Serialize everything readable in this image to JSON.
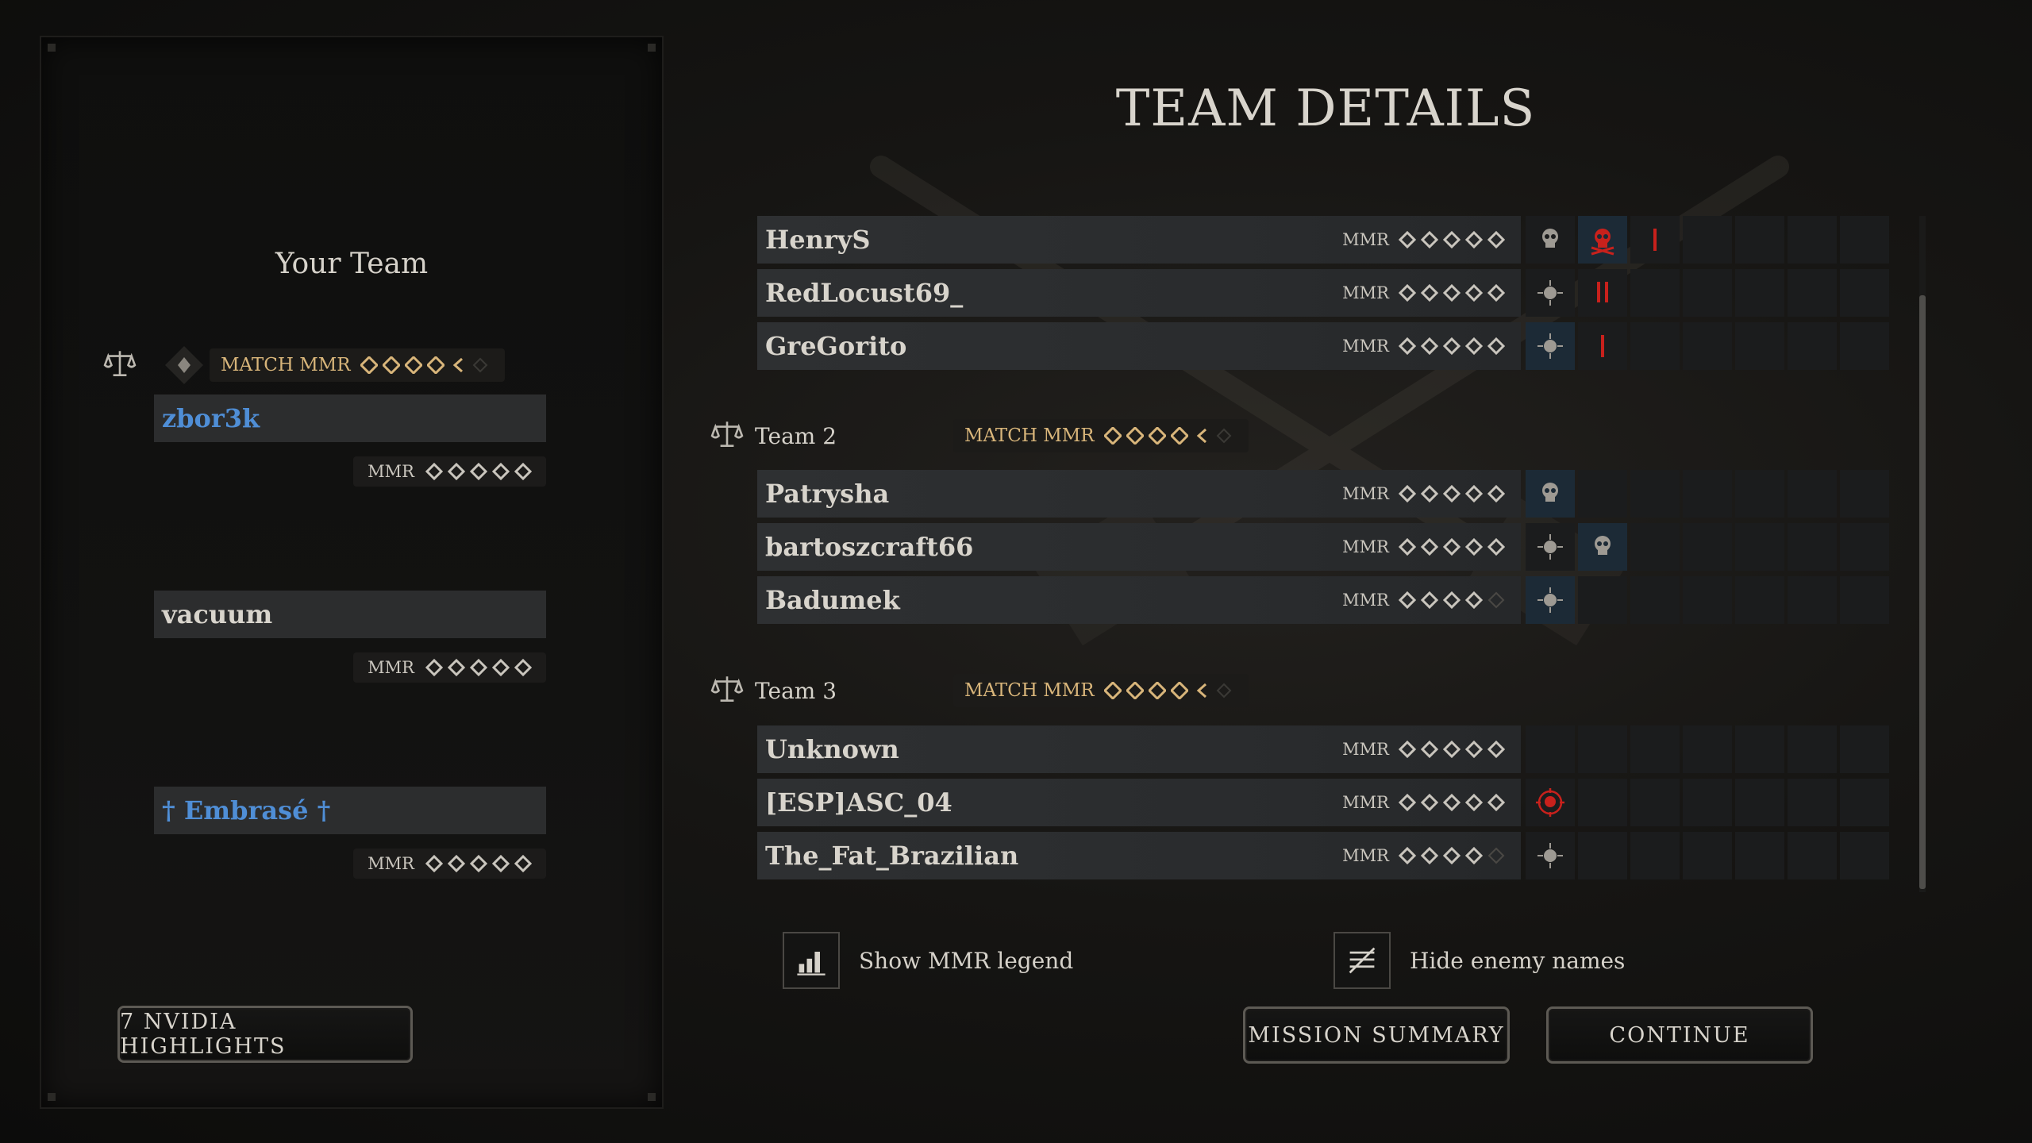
{
  "page_title": "TEAM DETAILS",
  "your_team": {
    "title": "Your Team",
    "match_mmr_label": "MATCH MMR",
    "players": [
      {
        "name": "zbor3k",
        "mmr_label": "MMR",
        "name_color": "#4f8ed6"
      },
      {
        "name": "vacuum",
        "mmr_label": "MMR",
        "name_color": "#d8d4cc"
      },
      {
        "name": "† Embrasé †",
        "mmr_label": "MMR",
        "name_color": "#4f8ed6"
      }
    ],
    "highlights_button": "7 NVIDIA HIGHLIGHTS"
  },
  "teams": [
    {
      "label": "",
      "match_mmr_label": "MATCH MMR",
      "players": [
        {
          "name": "HenryS",
          "mmr_label": "MMR",
          "stars": 5
        },
        {
          "name": "RedLocust69_",
          "mmr_label": "MMR",
          "stars": 5
        },
        {
          "name": "GreGorito",
          "mmr_label": "MMR",
          "stars": 5
        }
      ]
    },
    {
      "label": "Team 2",
      "match_mmr_label": "MATCH MMR",
      "players": [
        {
          "name": "Patrysha",
          "mmr_label": "MMR",
          "stars": 5
        },
        {
          "name": "bartoszcraft66",
          "mmr_label": "MMR",
          "stars": 5
        },
        {
          "name": "Badumek",
          "mmr_label": "MMR",
          "stars": 4
        }
      ]
    },
    {
      "label": "Team 3",
      "match_mmr_label": "MATCH MMR",
      "players": [
        {
          "name": "Unknown",
          "mmr_label": "MMR",
          "stars": 5
        },
        {
          "name": "[ESP]ASC_04",
          "mmr_label": "MMR",
          "stars": 5
        },
        {
          "name": "The_Fat_Brazilian",
          "mmr_label": "MMR",
          "stars": 4
        }
      ]
    }
  ],
  "toggles": {
    "mmr_legend": "Show MMR legend",
    "hide_names": "Hide enemy names"
  },
  "buttons": {
    "mission_summary": "MISSION SUMMARY",
    "continue": "CONTINUE"
  },
  "colors": {
    "gold": "#d8b57a",
    "team_blue": "#4f8ed6",
    "kill_red": "#c8211c"
  }
}
